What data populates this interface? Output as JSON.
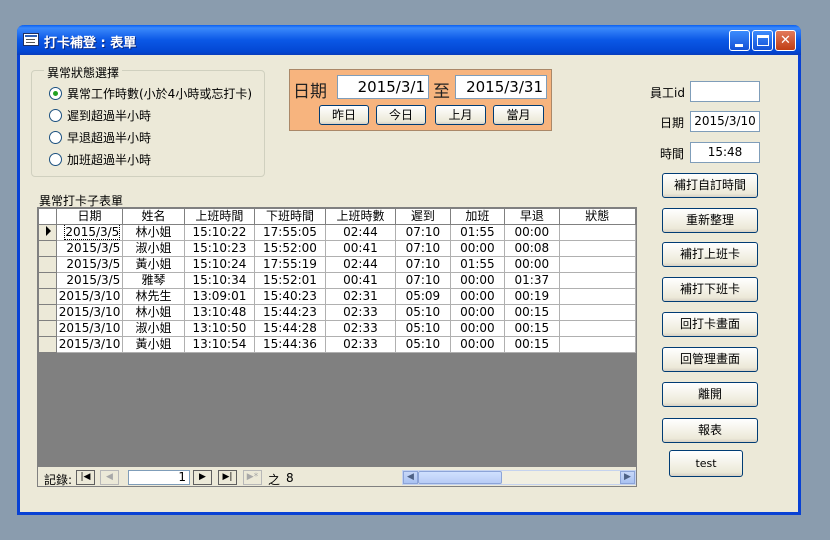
{
  "window": {
    "title": "打卡補登 : 表單"
  },
  "filter_group": {
    "label": "異常狀態選擇",
    "options": [
      {
        "label": "異常工作時數(小於4小時或忘打卡)",
        "selected": true
      },
      {
        "label": "遲到超過半小時",
        "selected": false
      },
      {
        "label": "早退超過半小時",
        "selected": false
      },
      {
        "label": "加班超過半小時",
        "selected": false
      }
    ]
  },
  "date_panel": {
    "date_label": "日期",
    "start_date": "2015/3/1",
    "to_label": "至",
    "end_date": "2015/3/31",
    "buttons": [
      "昨日",
      "今日",
      "上月",
      "當月"
    ]
  },
  "right_fields": {
    "employee_id_label": "員工id",
    "employee_id_value": "",
    "date_label": "日期",
    "date_value": "2015/3/10",
    "time_label": "時間",
    "time_value": "15:48"
  },
  "actions": [
    "補打自訂時間",
    "重新整理",
    "補打上班卡",
    "補打下班卡",
    "回打卡畫面",
    "回管理畫面",
    "離開",
    "報表",
    "test"
  ],
  "subform": {
    "caption": "異常打卡子表單",
    "columns": [
      "日期",
      "姓名",
      "上班時間",
      "下班時間",
      "上班時數",
      "遲到",
      "加班",
      "早退",
      "狀態"
    ],
    "rows": [
      [
        "2015/3/5",
        "林小姐",
        "15:10:22",
        "17:55:05",
        "02:44",
        "07:10",
        "01:55",
        "00:00",
        ""
      ],
      [
        "2015/3/5",
        "淑小姐",
        "15:10:23",
        "15:52:00",
        "00:41",
        "07:10",
        "00:00",
        "00:08",
        ""
      ],
      [
        "2015/3/5",
        "黃小姐",
        "15:10:24",
        "17:55:19",
        "02:44",
        "07:10",
        "01:55",
        "00:00",
        ""
      ],
      [
        "2015/3/5",
        "雅琴",
        "15:10:34",
        "15:52:01",
        "00:41",
        "07:10",
        "00:00",
        "01:37",
        ""
      ],
      [
        "2015/3/10",
        "林先生",
        "13:09:01",
        "15:40:23",
        "02:31",
        "05:09",
        "00:00",
        "00:19",
        ""
      ],
      [
        "2015/3/10",
        "林小姐",
        "13:10:48",
        "15:44:23",
        "02:33",
        "05:10",
        "00:00",
        "00:15",
        ""
      ],
      [
        "2015/3/10",
        "淑小姐",
        "13:10:50",
        "15:44:28",
        "02:33",
        "05:10",
        "00:00",
        "00:15",
        ""
      ],
      [
        "2015/3/10",
        "黃小姐",
        "13:10:54",
        "15:44:36",
        "02:33",
        "05:10",
        "00:00",
        "00:15",
        ""
      ]
    ]
  },
  "navigation": {
    "record_label": "記錄:",
    "current_record": "1",
    "of_label": "之",
    "total_records": "8"
  }
}
